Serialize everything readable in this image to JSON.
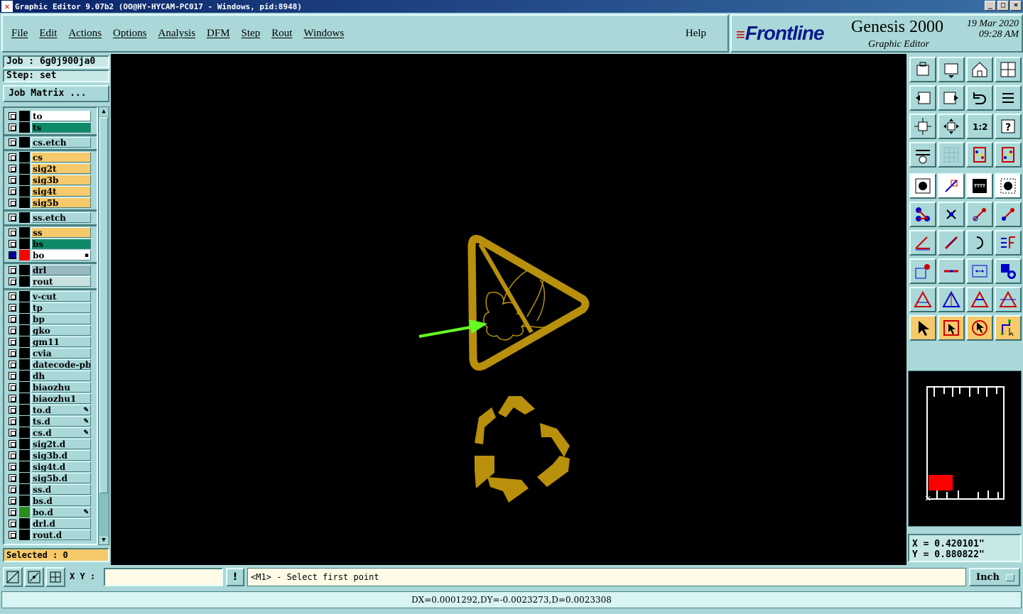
{
  "window": {
    "title": "Graphic Editor 9.07b2 (OO@HY-HYCAM-PC017 - Windows, pid:8948)"
  },
  "menu": {
    "items": [
      "File",
      "Edit",
      "Actions",
      "Options",
      "Analysis",
      "DFM",
      "Step",
      "Rout",
      "Windows"
    ],
    "help": "Help"
  },
  "brand": {
    "logo": "Frontline",
    "product": "Genesis 2000",
    "subtitle": "Graphic Editor",
    "date": "19 Mar 2020",
    "time": "09:28 AM"
  },
  "job": {
    "job_label": "Job : 6g0j900ja0",
    "step_label": "Step: set",
    "matrix_button": "Job Matrix ..."
  },
  "layers": [
    {
      "name": "to",
      "color": "#ffffff",
      "swatch": "#000000",
      "mark": ""
    },
    {
      "name": "ts",
      "color": "#0e8a68",
      "swatch": "#000000",
      "mark": ""
    },
    {
      "name": "cs.etch",
      "color": "#aad8d8",
      "swatch": "#000000",
      "mark": "",
      "gap": true
    },
    {
      "name": "cs",
      "color": "#f6c96a",
      "swatch": "#000000",
      "mark": "",
      "gap": true
    },
    {
      "name": "sig2t",
      "color": "#f6c96a",
      "swatch": "#000000",
      "mark": ""
    },
    {
      "name": "sig3b",
      "color": "#f6c96a",
      "swatch": "#000000",
      "mark": ""
    },
    {
      "name": "sig4t",
      "color": "#f6c96a",
      "swatch": "#000000",
      "mark": ""
    },
    {
      "name": "sig5b",
      "color": "#f6c96a",
      "swatch": "#000000",
      "mark": ""
    },
    {
      "name": "ss.etch",
      "color": "#aad8d8",
      "swatch": "#000000",
      "mark": "",
      "gap": true
    },
    {
      "name": "ss",
      "color": "#f6c96a",
      "swatch": "#000000",
      "mark": "",
      "gap": true
    },
    {
      "name": "bs",
      "color": "#0e8a68",
      "swatch": "#000000",
      "mark": ""
    },
    {
      "name": "bo",
      "color": "#ffffff",
      "swatch": "#ff0000",
      "mark": "▪",
      "active": true
    },
    {
      "name": "drl",
      "color": "#9ab8c0",
      "swatch": "#000000",
      "mark": "",
      "gap": true
    },
    {
      "name": "rout",
      "color": "#c8e0e0",
      "swatch": "#000000",
      "mark": ""
    },
    {
      "name": "v-cut",
      "color": "#aad8d8",
      "swatch": "#000000",
      "mark": "",
      "gap": true
    },
    {
      "name": "tp",
      "color": "#aad8d8",
      "swatch": "#000000",
      "mark": ""
    },
    {
      "name": "bp",
      "color": "#aad8d8",
      "swatch": "#000000",
      "mark": ""
    },
    {
      "name": "gko",
      "color": "#aad8d8",
      "swatch": "#000000",
      "mark": ""
    },
    {
      "name": "gm11",
      "color": "#aad8d8",
      "swatch": "#000000",
      "mark": ""
    },
    {
      "name": "cvia",
      "color": "#aad8d8",
      "swatch": "#000000",
      "mark": ""
    },
    {
      "name": "datecode-pbc",
      "color": "#aad8d8",
      "swatch": "#000000",
      "mark": ""
    },
    {
      "name": "dh",
      "color": "#aad8d8",
      "swatch": "#000000",
      "mark": ""
    },
    {
      "name": "biaozhu",
      "color": "#aad8d8",
      "swatch": "#000000",
      "mark": ""
    },
    {
      "name": "biaozhu1",
      "color": "#aad8d8",
      "swatch": "#000000",
      "mark": ""
    },
    {
      "name": "to.d",
      "color": "#aad8d8",
      "swatch": "#000000",
      "mark": "✎"
    },
    {
      "name": "ts.d",
      "color": "#aad8d8",
      "swatch": "#000000",
      "mark": "✎"
    },
    {
      "name": "cs.d",
      "color": "#aad8d8",
      "swatch": "#000000",
      "mark": "✎"
    },
    {
      "name": "sig2t.d",
      "color": "#aad8d8",
      "swatch": "#000000",
      "mark": ""
    },
    {
      "name": "sig3b.d",
      "color": "#aad8d8",
      "swatch": "#000000",
      "mark": ""
    },
    {
      "name": "sig4t.d",
      "color": "#aad8d8",
      "swatch": "#000000",
      "mark": ""
    },
    {
      "name": "sig5b.d",
      "color": "#aad8d8",
      "swatch": "#000000",
      "mark": ""
    },
    {
      "name": "ss.d",
      "color": "#aad8d8",
      "swatch": "#000000",
      "mark": ""
    },
    {
      "name": "bs.d",
      "color": "#aad8d8",
      "swatch": "#000000",
      "mark": ""
    },
    {
      "name": "bo.d",
      "color": "#aad8d8",
      "swatch": "#2e8b1e",
      "mark": "✎"
    },
    {
      "name": "drl.d",
      "color": "#aad8d8",
      "swatch": "#000000",
      "mark": ""
    },
    {
      "name": "rout.d",
      "color": "#aad8d8",
      "swatch": "#000000",
      "mark": ""
    }
  ],
  "selected": "Selected : 0",
  "coords": {
    "x": "X = 0.420101\"",
    "y": "Y = 0.880822\""
  },
  "status": {
    "xy_label": "X Y :",
    "xy_value": "",
    "bang": "!",
    "prompt": "<M1> - Select first point",
    "unit": "Inch"
  },
  "measure": "DX=0.0001292,DY=-0.0023273,D=0.0023308",
  "colors": {
    "artwork": "#b8900c",
    "arrow": "#66ff22",
    "panel": "#aad8d8"
  }
}
